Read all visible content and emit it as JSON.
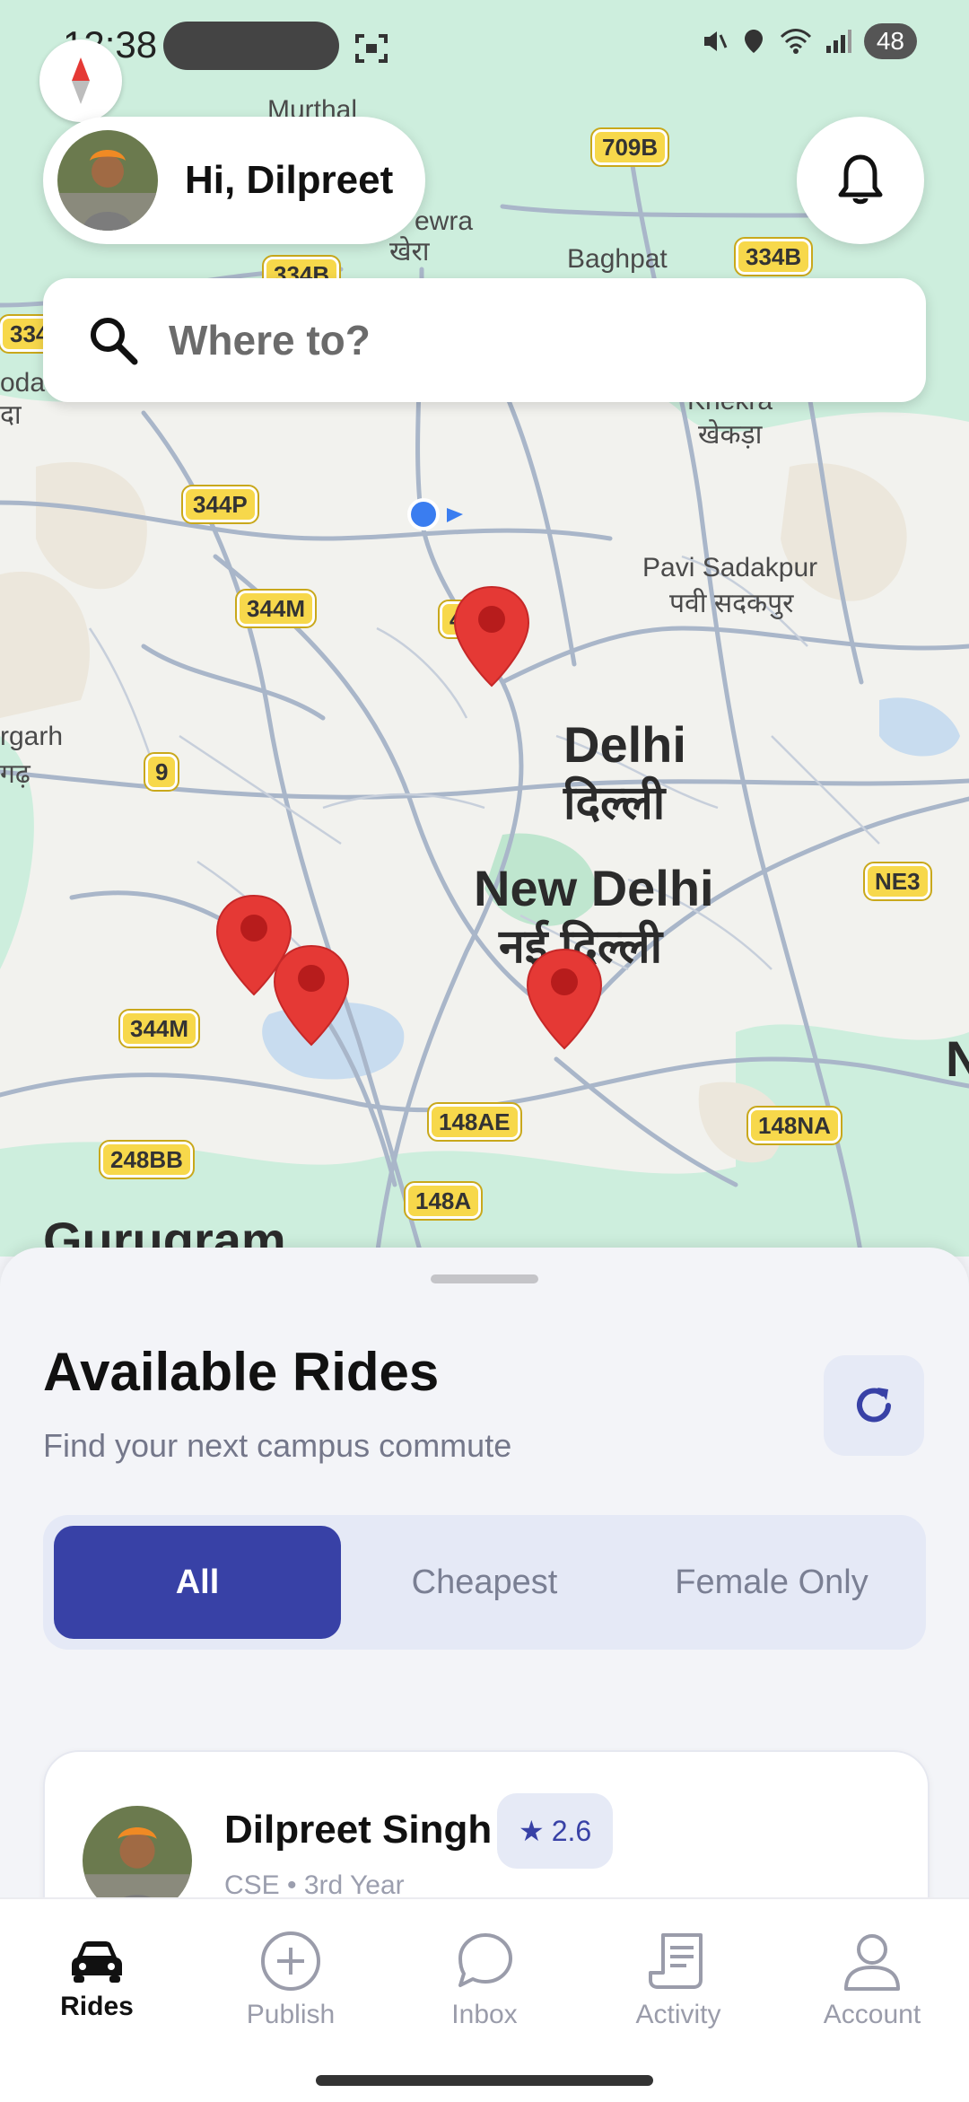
{
  "status_bar": {
    "time": "12:38",
    "battery": "48"
  },
  "header": {
    "greeting": "Hi, Dilpreet"
  },
  "search": {
    "placeholder": "Where to?"
  },
  "map": {
    "labels": {
      "murthal": "Murthal",
      "khewra_en": "ewra",
      "khewra_hi": "खेरा",
      "baghpat": "Baghpat",
      "khekra_en": "Khekra",
      "khekra_hi": "खेकड़ा",
      "oda": "oda",
      "da": "दा",
      "pavi_en": "Pavi Sadakpur",
      "pavi_hi": "पवी सदकपुर",
      "rgarh_en": "rgarh",
      "rgarh_hi": "गढ़",
      "delhi_en": "Delhi",
      "delhi_hi": "दिल्ली",
      "newdelhi_en": "New Delhi",
      "newdelhi_hi": "नई दिल्ली",
      "gurugram": "Gurugram",
      "n_edge": "N"
    },
    "shields": {
      "s709b": "709B",
      "s334b_a": "334B",
      "s334b_b": "334B",
      "s334": "334",
      "s344p": "344P",
      "s344m_a": "344M",
      "s4": "4",
      "s9": "9",
      "ne3": "NE3",
      "s344m_b": "344M",
      "s148ae": "148AE",
      "s148na": "148NA",
      "s248bb": "248BB",
      "s148a": "148A"
    }
  },
  "sheet": {
    "title": "Available Rides",
    "subtitle": "Find your next campus commute",
    "filters": [
      "All",
      "Cheapest",
      "Female Only"
    ],
    "active_filter": "All"
  },
  "ride_card": {
    "driver_name": "Dilpreet Singh",
    "rating": "2.6",
    "meta": "CSE • 3rd Year"
  },
  "nav": {
    "items": [
      {
        "label": "Rides",
        "icon": "car-icon",
        "active": true
      },
      {
        "label": "Publish",
        "icon": "plus-circle-icon",
        "active": false
      },
      {
        "label": "Inbox",
        "icon": "chat-icon",
        "active": false
      },
      {
        "label": "Activity",
        "icon": "receipt-icon",
        "active": false
      },
      {
        "label": "Account",
        "icon": "person-icon",
        "active": false
      }
    ]
  },
  "colors": {
    "accent": "#3841a6",
    "pin": "#e53935",
    "map_green": "#cdeedd",
    "map_land": "#f2f2ee"
  }
}
